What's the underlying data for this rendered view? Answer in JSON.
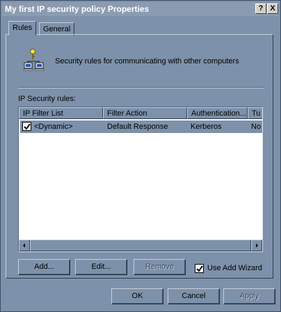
{
  "window": {
    "title": "My first IP security policy Properties",
    "help_glyph": "?",
    "close_glyph": "X"
  },
  "tabs": [
    {
      "label": "Rules",
      "active": true
    },
    {
      "label": "General",
      "active": false
    }
  ],
  "header": {
    "icon": "network-computers-key-icon",
    "text": "Security rules for communicating with other computers"
  },
  "rules_section": {
    "label": "IP Security rules:"
  },
  "table": {
    "columns": [
      "IP Filter List",
      "Filter Action",
      "Authentication...",
      "Tu"
    ],
    "rows": [
      {
        "checked": true,
        "filter_list": "<Dynamic>",
        "filter_action": "Default Response",
        "authentication": "Kerberos",
        "tunnel": "No"
      }
    ]
  },
  "actions": {
    "add_label": "Add...",
    "edit_label": "Edit...",
    "remove_label": "Remove",
    "remove_enabled": false,
    "use_wizard_label": "Use Add Wizard",
    "use_wizard_checked": true
  },
  "footer": {
    "ok_label": "OK",
    "cancel_label": "Cancel",
    "apply_label": "Apply",
    "apply_enabled": false
  },
  "colors": {
    "face": "#7d91aa",
    "list_background": "#ffffff"
  }
}
